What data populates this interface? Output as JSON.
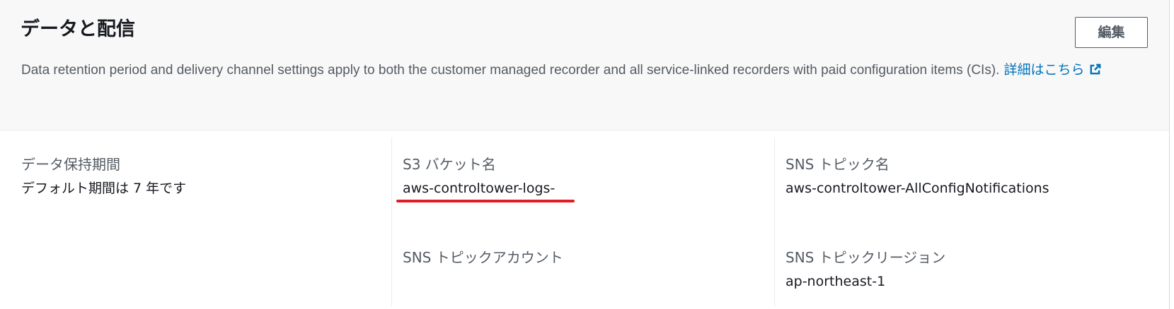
{
  "panel": {
    "title": "データと配信",
    "edit_button_label": "編集",
    "description": "Data retention period and delivery channel settings apply to both the customer managed recorder and all service-linked recorders with paid configuration items (CIs).",
    "learn_more_label": "詳細はこちら",
    "learn_more_icon": "external-link-icon"
  },
  "fields": {
    "retention": {
      "label": "データ保持期間",
      "value": "デフォルト期間は 7 年です"
    },
    "s3_bucket": {
      "label": "S3 バケット名",
      "value": "aws-controltower-logs-"
    },
    "sns_topic": {
      "label": "SNS トピック名",
      "value": "aws-controltower-AllConfigNotifications"
    },
    "sns_account": {
      "label": "SNS トピックアカウント",
      "value": ""
    },
    "sns_region": {
      "label": "SNS トピックリージョン",
      "value": "ap-northeast-1"
    }
  },
  "colors": {
    "link": "#0073bb",
    "annotation_underline": "#e31b23",
    "header_background": "#f8f8f8"
  }
}
